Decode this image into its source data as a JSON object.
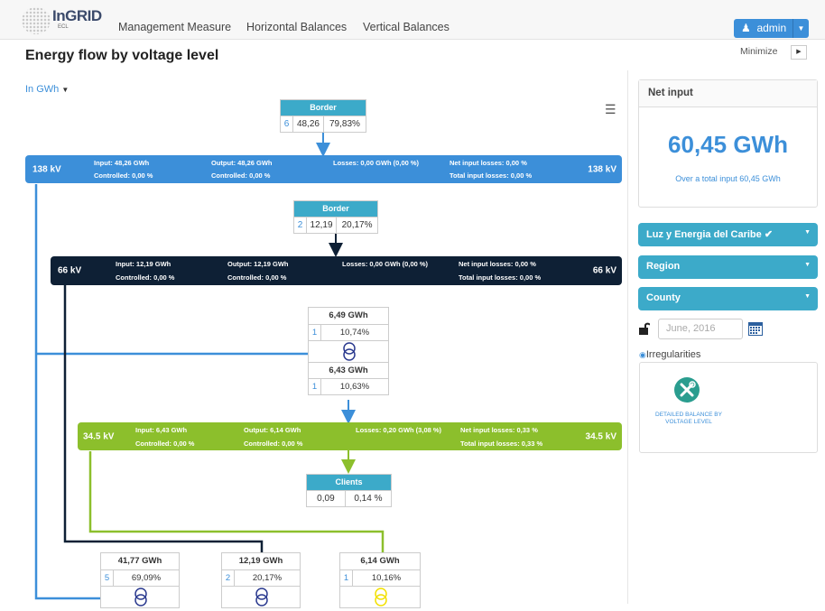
{
  "app": {
    "logo_name": "InGRID",
    "logo_sub": "ECL"
  },
  "nav": {
    "items": [
      "Management Measure",
      "Horizontal Balances",
      "Vertical Balances"
    ],
    "user": "admin"
  },
  "page": {
    "title": "Energy flow by voltage level",
    "unit": "In GWh",
    "minimize": "Minimize"
  },
  "diagram": {
    "border1": {
      "title": "Border",
      "count": "6",
      "value": "48,26",
      "pct": "79,83%"
    },
    "border2": {
      "title": "Border",
      "count": "2",
      "value": "12,19",
      "pct": "20,17%"
    },
    "level138": {
      "kv": "138 kV",
      "input": "Input: 48,26 GWh",
      "output": "Output: 48,26 GWh",
      "losses": "Losses: 0,00 GWh (0,00 %)",
      "net_losses": "Net input losses: 0,00 %",
      "controlled_in": "Controlled: 0,00 %",
      "controlled_out": "Controlled: 0,00 %",
      "total_losses": "Total input losses: 0,00 %"
    },
    "level66": {
      "kv": "66 kV",
      "input": "Input: 12,19 GWh",
      "output": "Output: 12,19 GWh",
      "losses": "Losses: 0,00 GWh (0,00 %)",
      "net_losses": "Net input losses: 0,00 %",
      "controlled_in": "Controlled: 0,00 %",
      "controlled_out": "Controlled: 0,00 %",
      "total_losses": "Total input losses: 0,00 %"
    },
    "level345": {
      "kv": "34.5 kV",
      "input": "Input: 6,43 GWh",
      "output": "Output: 6,14 GWh",
      "losses": "Losses: 0,20 GWh (3,08 %)",
      "net_losses": "Net input losses: 0,33 %",
      "controlled_in": "Controlled: 0,00 %",
      "controlled_out": "Controlled: 0,00 %",
      "total_losses": "Total input losses: 0,33 %"
    },
    "transformer": {
      "top_value": "6,49 GWh",
      "top_count": "1",
      "top_pct": "10,74%",
      "bottom_value": "6,43 GWh",
      "bottom_count": "1",
      "bottom_pct": "10,63%"
    },
    "clients": {
      "title": "Clients",
      "value": "0,09",
      "pct": "0,14 %"
    },
    "bottom_nodes": [
      {
        "value": "41,77 GWh",
        "count": "5",
        "pct": "69,09%"
      },
      {
        "value": "12,19 GWh",
        "count": "2",
        "pct": "20,17%"
      },
      {
        "value": "6,14 GWh",
        "count": "1",
        "pct": "10,16%"
      }
    ],
    "colors": {
      "blue": "#3c8fd9",
      "navy": "#0e2035",
      "green": "#8cbf2c",
      "teal": "#3caac9",
      "yellow": "#f2e000"
    }
  },
  "sidebar": {
    "net_input_title": "Net input",
    "net_input_value": "60,45 GWh",
    "net_input_sub": "Over a total input 60,45 GWh",
    "filters": [
      "Luz y Energia del Caribe ✔",
      "Region",
      "County"
    ],
    "date": "June, 2016",
    "irregularities": "Irregularities",
    "detail_label": "DETAILED BALANCE BY VOLTAGE LEVEL"
  }
}
